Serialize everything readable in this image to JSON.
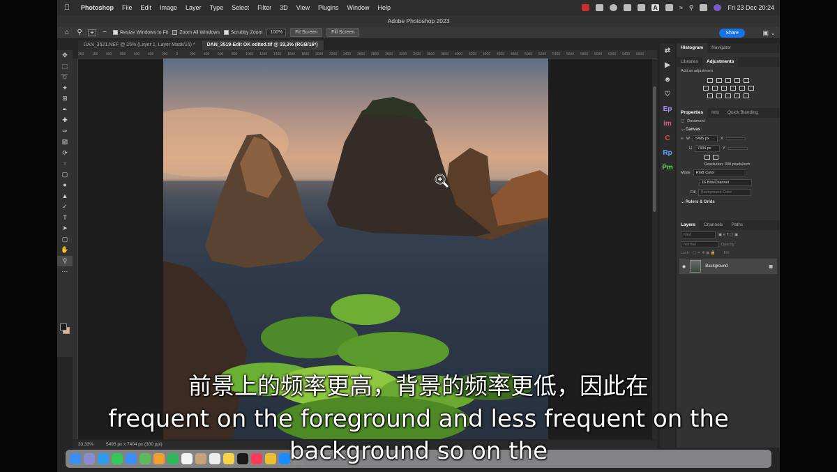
{
  "menubar": {
    "app": "Photoshop",
    "items": [
      "File",
      "Edit",
      "Image",
      "Layer",
      "Type",
      "Select",
      "Filter",
      "3D",
      "View",
      "Plugins",
      "Window",
      "Help"
    ],
    "clock": "Fri 23 Dec  20:24",
    "status_letter": "A"
  },
  "window": {
    "title": "Adobe Photoshop 2023"
  },
  "options": {
    "resize_windows": "Resize Windows to Fit",
    "zoom_all": "Zoom All Windows",
    "scrubby_zoom": "Scrubby Zoom",
    "zoom_value": "100%",
    "fit_screen": "Fit Screen",
    "fill_screen": "Fill Screen",
    "share": "Share"
  },
  "tabs": [
    {
      "label": "DAN_3521.NEF @ 25% (Layer 1, Layer Mask/16) *"
    },
    {
      "label": "DAN_3519-Edit OK edited.tif @ 33,3% (RGB/16*)"
    }
  ],
  "ruler_ticks": [
    "200",
    "100",
    "900",
    "800",
    "600",
    "400",
    "200",
    "0",
    "200",
    "400",
    "600",
    "800",
    "1000",
    "1200",
    "1400",
    "1600",
    "1800",
    "2000",
    "2200",
    "2400",
    "2600",
    "2800",
    "3000",
    "3200",
    "3400",
    "3600",
    "3800",
    "4000",
    "4200",
    "4400",
    "4600",
    "4800",
    "5000",
    "5200",
    "5400",
    "5600",
    "5800",
    "6000",
    "6200",
    "6400",
    "6600"
  ],
  "statusbar": {
    "zoom": "33,33%",
    "doc_info": "5495 px x 7404 px (300 ppi)"
  },
  "iconstrip": [
    "Ep",
    "im",
    "C",
    "Rp",
    "Pm"
  ],
  "panels": {
    "group1_tabs": [
      "Histogram",
      "Navigator"
    ],
    "group2_tabs": [
      "Libraries",
      "Adjustments"
    ],
    "add_adjustment": "Add an adjustment",
    "group3_tabs": [
      "Properties",
      "Info",
      "Quick Blending"
    ],
    "document_label": "Document",
    "canvas_section": "Canvas",
    "width_label": "W",
    "width_value": "5495 px",
    "height_label": "H",
    "height_value": "7404 px",
    "x_label": "X",
    "y_label": "Y",
    "resolution": "Resolution: 300 pixels/inch",
    "mode_label": "Mode",
    "mode_value": "RGB Color",
    "bits_value": "16 Bits/Channel",
    "fill_label": "Fill",
    "fill_value": "Background Color",
    "rulers_section": "Rulers & Grids",
    "layers_tabs": [
      "Layers",
      "Channels",
      "Paths"
    ],
    "kind_placeholder": "Kind",
    "blend_mode": "Normal",
    "opacity_label": "Opacity:",
    "lock_label": "Lock:",
    "fill_short": "Fill:",
    "layer_name": "Background"
  },
  "subtitles": {
    "zh": "前景上的频率更高，背景的频率更低，因此在",
    "en1": "frequent on the foreground and less frequent on the",
    "en2": "background so on the"
  }
}
